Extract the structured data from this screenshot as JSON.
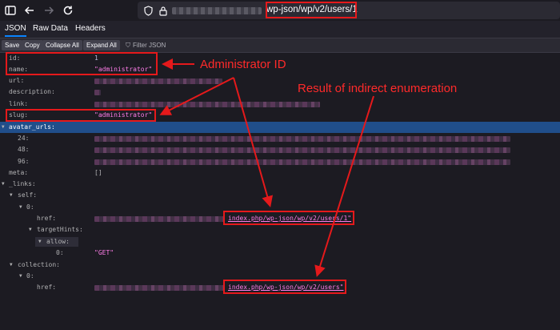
{
  "browser": {
    "url_suffix": "wp-json/wp/v2/users/1"
  },
  "viewer_tabs": [
    "JSON",
    "Raw Data",
    "Headers"
  ],
  "toolbar": {
    "save": "Save",
    "copy": "Copy",
    "collapse_all": "Collapse All",
    "expand_all": "Expand All",
    "filter_placeholder": "Filter JSON"
  },
  "json": {
    "id_key": "id:",
    "id_val": "1",
    "name_key": "name:",
    "name_val": "\"administrator\"",
    "url_key": "url:",
    "description_key": "description:",
    "link_key": "link:",
    "slug_key": "slug:",
    "slug_val": "\"administrator\"",
    "avatar_key": "avatar_urls:",
    "size_24": "24:",
    "size_48": "48:",
    "size_96": "96:",
    "meta_key": "meta:",
    "meta_val": "[]",
    "links_key": "_links:",
    "self_key": "self:",
    "zero_key": "0:",
    "href_key": "href:",
    "self_href": "index.php/wp-json/wp/v2/users/1\"",
    "targethints_key": "targetHints:",
    "allow_key": "allow:",
    "allow_zero_key": "0:",
    "allow_val": "\"GET\"",
    "collection_key": "collection:",
    "collection_zero_key": "0:",
    "collection_href_key": "href:",
    "collection_href": "index.php/wp-json/wp/v2/users\""
  },
  "annotations": {
    "admin_id": "Administrator ID",
    "result": "Result of indirect enumeration"
  },
  "colors": {
    "annotation_red": "#e5191b",
    "selected_row": "#204e8a",
    "key_blue": "#75bfff",
    "string_pink": "#ff7de9"
  }
}
